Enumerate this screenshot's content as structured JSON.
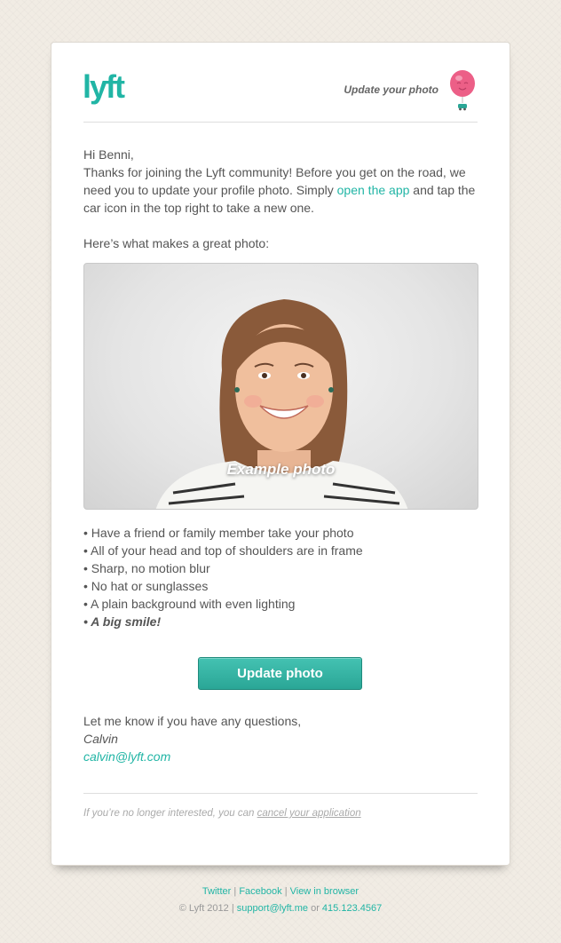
{
  "header": {
    "logo_text": "lyft",
    "title": "Update your photo"
  },
  "body": {
    "greeting": "Hi Benni,",
    "intro_before": "Thanks for joining the Lyft community! Before you get on the road, we need you to update your profile photo. Simply ",
    "intro_link": "open the app",
    "intro_after": " and tap the car icon in the top right to take a new one.",
    "great_photo_heading": "Here’s what makes a great photo:",
    "photo_caption": "Example photo",
    "tips": [
      "Have a friend or family member take your photo",
      "All of your head and top of shoulders are in frame",
      "Sharp, no motion blur",
      "No hat or sunglasses",
      "A plain background with even lighting",
      "A big smile!"
    ],
    "bullet": "•",
    "cta_label": "Update photo",
    "closing": "Let me know if you have any questions,",
    "signature": "Calvin",
    "signature_email": "calvin@lyft.com",
    "unsubscribe_prefix": "If you’re no longer interested, you can ",
    "unsubscribe_link": "cancel your application"
  },
  "footer": {
    "twitter": "Twitter",
    "facebook": "Facebook",
    "view_in_browser": "View in browser",
    "separator": "|",
    "copyright": "© Lyft 2012",
    "support_email": "support@lyft.me",
    "or": "or",
    "phone": "415.123.4567"
  },
  "colors": {
    "brand_teal": "#21b5a5",
    "balloon_pink": "#ec5f87",
    "background": "#f1ece4"
  },
  "icons": {
    "logo": "lyft-logo",
    "balloon": "balloon-icon",
    "car": "car-icon"
  }
}
